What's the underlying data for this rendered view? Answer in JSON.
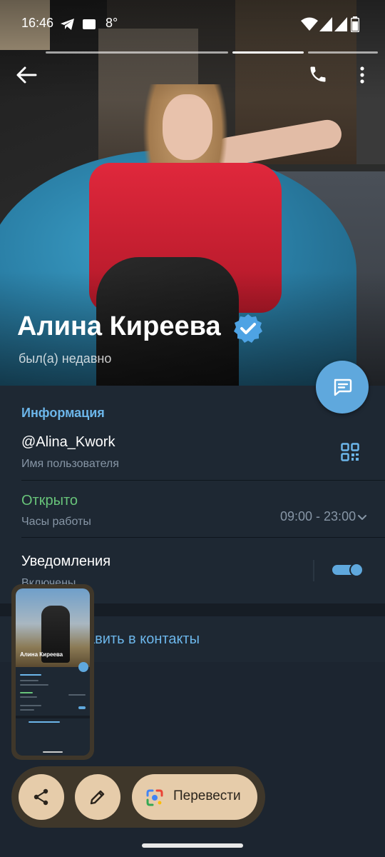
{
  "status_bar": {
    "time": "16:46",
    "temperature": "8°",
    "icons": [
      "telegram-icon",
      "message-icon",
      "wifi-icon",
      "signal-icon",
      "signal-icon",
      "battery-icon"
    ]
  },
  "toolbar": {
    "back_icon": "arrow-left-icon",
    "call_icon": "phone-icon",
    "more_icon": "more-vertical-icon"
  },
  "profile": {
    "name": "Алина Киреева",
    "last_seen": "был(а) недавно",
    "verified_icon": "verified-badge-icon",
    "message_fab_icon": "message-icon"
  },
  "info": {
    "section_title": "Информация",
    "username": "@Alina_Kwork",
    "username_label": "Имя пользователя",
    "qr_icon": "qr-code-icon",
    "status": "Открыто",
    "hours_label": "Часы работы",
    "hours_value": "09:00 - 23:00",
    "notifications_label": "Уведомления",
    "notifications_sub": "Включены",
    "notifications_enabled": true
  },
  "add_contact": {
    "label": "авить в контакты"
  },
  "thumbnail": {
    "name": "Алина Киреева"
  },
  "actions": {
    "share_icon": "share-icon",
    "edit_icon": "pencil-icon",
    "translate_icon": "google-lens-icon",
    "translate_label": "Перевести"
  },
  "colors": {
    "accent": "#6cb6ea",
    "open_green": "#68c47a",
    "panel_bg": "#1e2833",
    "fab": "#5fa8dd",
    "action_chip": "#e6ccaa"
  }
}
